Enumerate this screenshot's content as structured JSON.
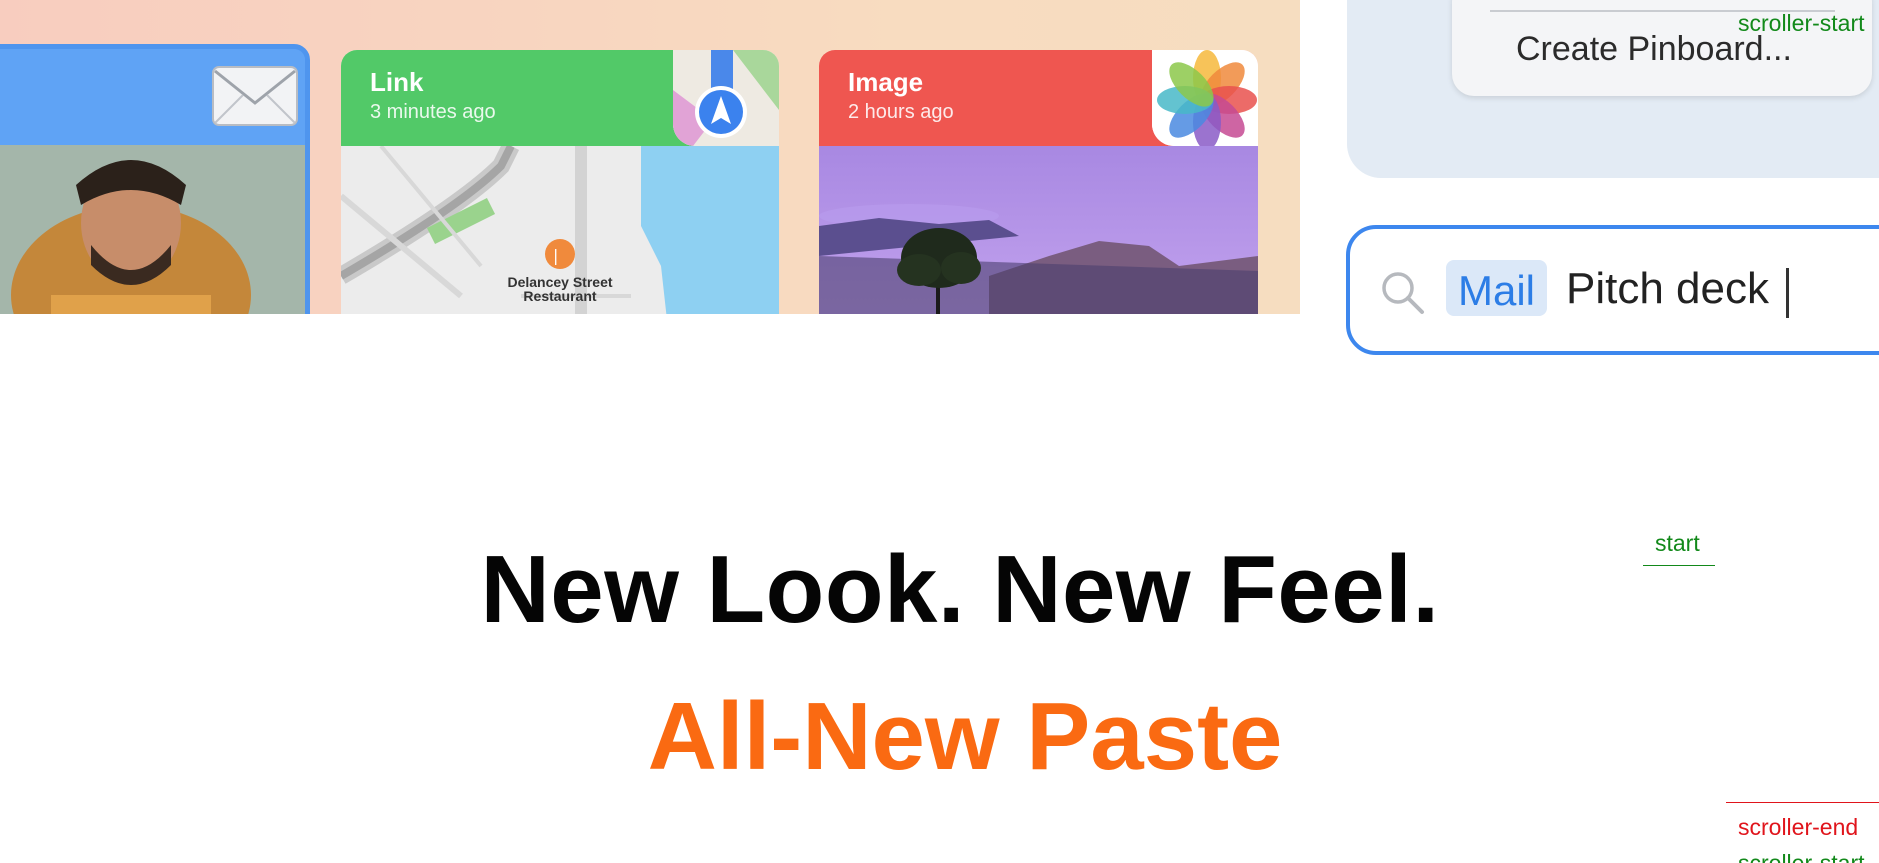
{
  "hero": {
    "cards": [
      {
        "type": "mail",
        "icon": "mail-icon",
        "color": "#5fa3f5"
      },
      {
        "type": "link",
        "title": "Link",
        "subtitle": "3 minutes ago",
        "icon": "maps-icon",
        "color": "#52c968",
        "map_label_line1": "Delancey Street",
        "map_label_line2": "Restaurant"
      },
      {
        "type": "image",
        "title": "Image",
        "subtitle": "2 hours ago",
        "icon": "photos-icon",
        "color": "#ef5650"
      }
    ]
  },
  "side_menu": {
    "create_pinboard_label": "Create Pinboard..."
  },
  "search": {
    "token": "Mail",
    "query": "Pitch deck",
    "accent": "#3d87ee"
  },
  "headline": "New Look. New Feel.",
  "subheadline": "All-New Paste",
  "subheadline_color": "#fa6a12",
  "markers": {
    "scroller_start": "scroller-start",
    "start": "start",
    "scroller_end": "scroller-end",
    "scroller_start_bottom": "scroller-start"
  }
}
